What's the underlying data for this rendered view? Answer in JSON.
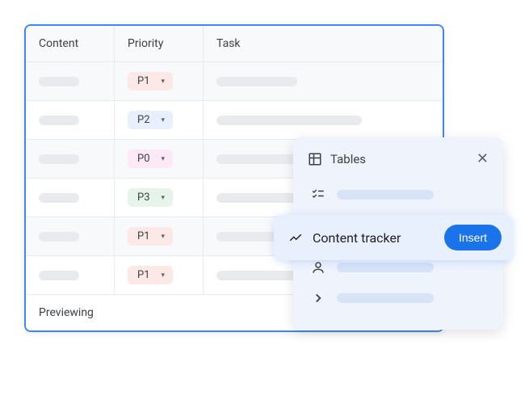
{
  "table": {
    "headers": {
      "content": "Content",
      "priority": "Priority",
      "task": "Task"
    },
    "rows": [
      {
        "priority": "P1",
        "priority_class": "p1"
      },
      {
        "priority": "P2",
        "priority_class": "p2"
      },
      {
        "priority": "P0",
        "priority_class": "p0"
      },
      {
        "priority": "P3",
        "priority_class": "p3"
      },
      {
        "priority": "P1",
        "priority_class": "p1"
      },
      {
        "priority": "P1",
        "priority_class": "p1"
      }
    ],
    "footer": "Previewing"
  },
  "popup": {
    "title": "Tables",
    "highlighted": {
      "label": "Content tracker",
      "button": "Insert"
    }
  }
}
